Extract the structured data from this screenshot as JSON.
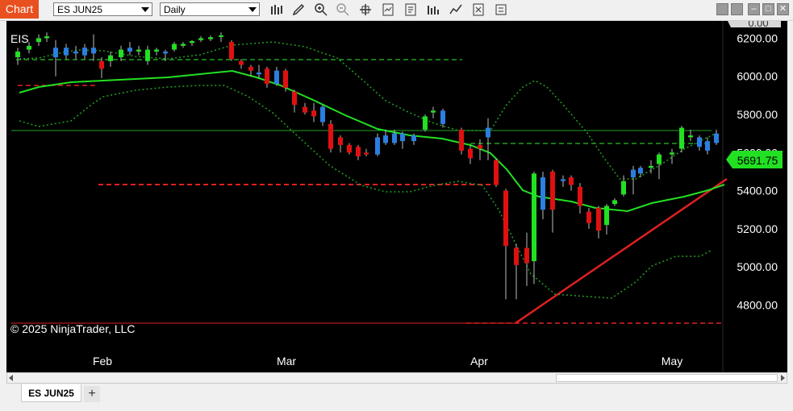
{
  "window": {
    "title": "Chart",
    "instrument": "ES JUN25",
    "interval": "Daily",
    "tab_label": "ES JUN25",
    "add_tab": "+",
    "minimize": "–",
    "maximize": "□",
    "close": "✕"
  },
  "chart": {
    "symbol_label": "EIS",
    "copyright": "© 2025 NinjaTrader, LLC",
    "last_price": "5691.75",
    "top_tag": "0.00",
    "colors": {
      "up": "#22e022",
      "down": "#e01010",
      "doji_blue": "#2a7fe0",
      "sma": "#22e022",
      "bands": "#22a022",
      "level_red": "#e02020",
      "level_green": "#22a022"
    }
  },
  "chart_data": {
    "type": "candlestick",
    "yaxis_ticks": [
      "6200.00",
      "6000.00",
      "5800.00",
      "5600.00",
      "5400.00",
      "5200.00",
      "5000.00",
      "4800.00"
    ],
    "xaxis_ticks": [
      "Feb",
      "Mar",
      "Apr",
      "May"
    ],
    "ylim": [
      4725,
      6310
    ],
    "overlays": [
      "SMA",
      "Bollinger Bands",
      "Horizontal levels",
      "Trend line"
    ]
  }
}
